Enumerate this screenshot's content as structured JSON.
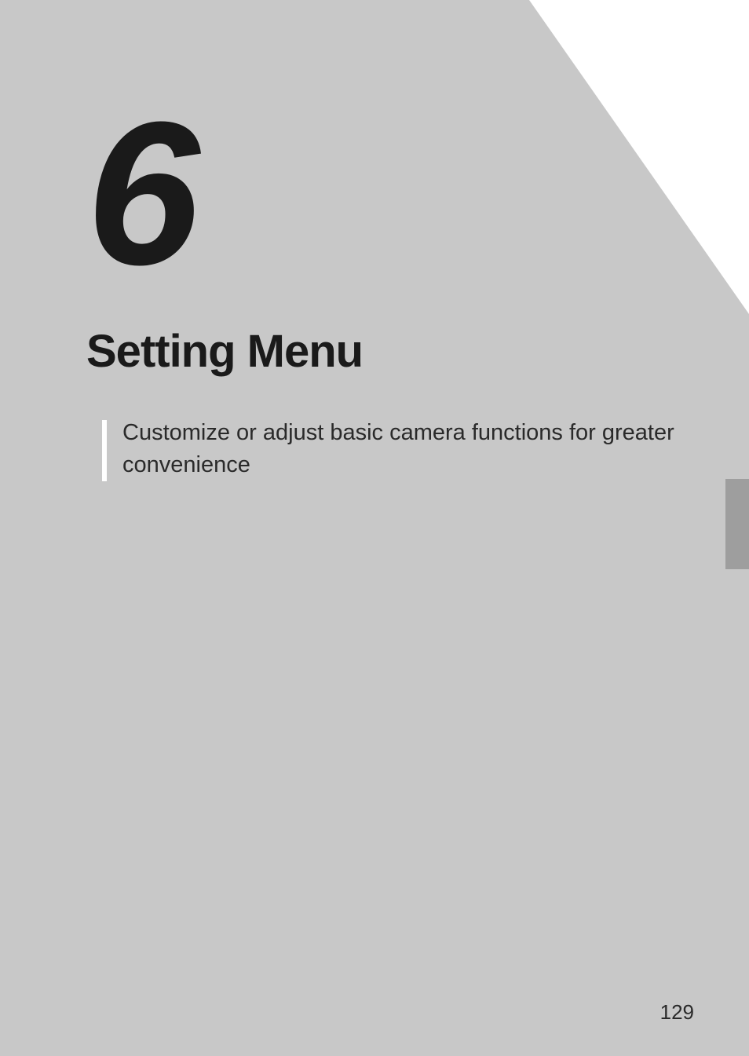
{
  "chapter": {
    "number": "6",
    "title": "Setting Menu",
    "description": "Customize or adjust basic camera functions for greater convenience"
  },
  "page_number": "129"
}
